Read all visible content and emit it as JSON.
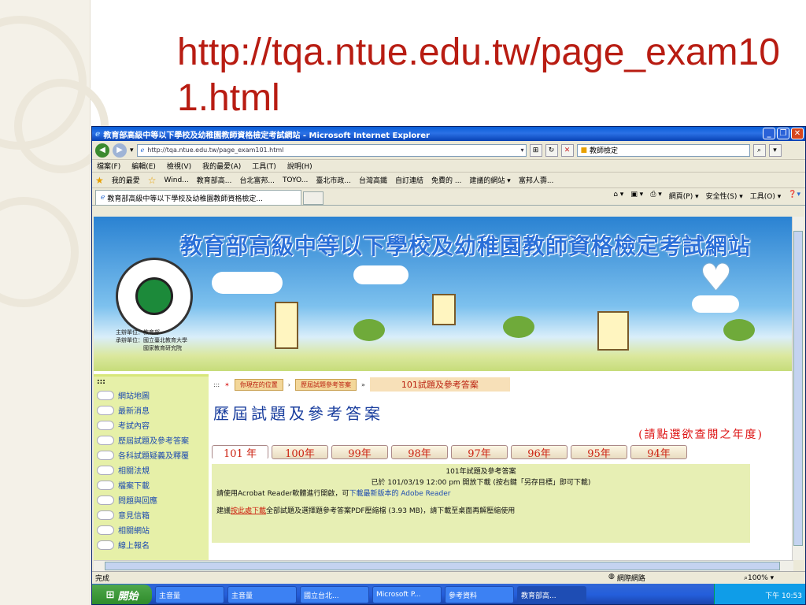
{
  "slide": {
    "title": "http://tqa.ntue.edu.tw/page_exam101.html"
  },
  "window": {
    "title": "教育部高級中等以下學校及幼稚園教師資格檢定考試網站 - Microsoft Internet Explorer",
    "address": "http://tqa.ntue.edu.tw/page_exam101.html",
    "search": "教師檢定",
    "menu": [
      "檔案(F)",
      "編輯(E)",
      "檢視(V)",
      "我的最愛(A)",
      "工具(T)",
      "說明(H)"
    ],
    "favorites_label": "我的最愛",
    "favorites": [
      "Wind...",
      "教育部高...",
      "台北富邦...",
      "TOYO...",
      "臺北市政...",
      "台灣高鐵",
      "自訂連結",
      "免費的 ...",
      "建議的網站 ▾",
      "富邦人壽..."
    ],
    "tab_title": "教育部高級中等以下學校及幼稚園教師資格檢定...",
    "commands": [
      "網頁(P) ▾",
      "安全性(S) ▾",
      "工具(O) ▾"
    ]
  },
  "banner": {
    "title": "教育部高級中等以下學校及幼稚園教師資格檢定考試網站",
    "seal_text": "MINISTRY OF EDUCATION",
    "seal_chinese": "教育部",
    "sponsor": "主辦單位：教育部\n承辦單位：國立臺北教育大學\n　　　　　國家教育研究院"
  },
  "leftnav": {
    "dots": ":::",
    "items": [
      "網站地圖",
      "最新消息",
      "考試內容",
      "歷屆試題及參考答案",
      "各科試題疑義及釋覆",
      "相關法規",
      "檔案下載",
      "問題與回應",
      "意見信箱",
      "相關網站",
      "線上報名"
    ]
  },
  "main": {
    "dots": ":::",
    "breadcrumb_label": "你現在的位置",
    "breadcrumb_page": "歷屆試題參考答案",
    "breadcrumb_current": "101試題及參考答案",
    "heading": "歷屆試題及參考答案",
    "hint": "(請點選欲查閱之年度)",
    "years": [
      "101 年",
      "100年",
      "99年",
      "98年",
      "97年",
      "96年",
      "95年",
      "94年"
    ],
    "info_title": "101年試題及參考答案",
    "info_release": "已於 101/03/19 12:00 pm 開放下載 (按右鍵「另存目標」即可下載)",
    "acrobat_pre": "請使用Acrobat Reader軟體進行開啟，可",
    "acrobat_link": "下載最新版本的 Adobe Reader",
    "download_pre": "建議",
    "download_link": "按此處下載",
    "download_post": "全部試題及選擇題參考答案PDF壓縮檔 (3.93 MB)，請下載至桌面再解壓縮使用"
  },
  "status": {
    "left": "完成",
    "zone": "網際網路",
    "zoom": "100%"
  },
  "taskbar": {
    "start": "開始",
    "tasks": [
      "主音量",
      "主音量",
      "國立台北...",
      "Microsoft P...",
      "參考資料",
      "教育部高..."
    ],
    "clock": "下午 10:53"
  }
}
